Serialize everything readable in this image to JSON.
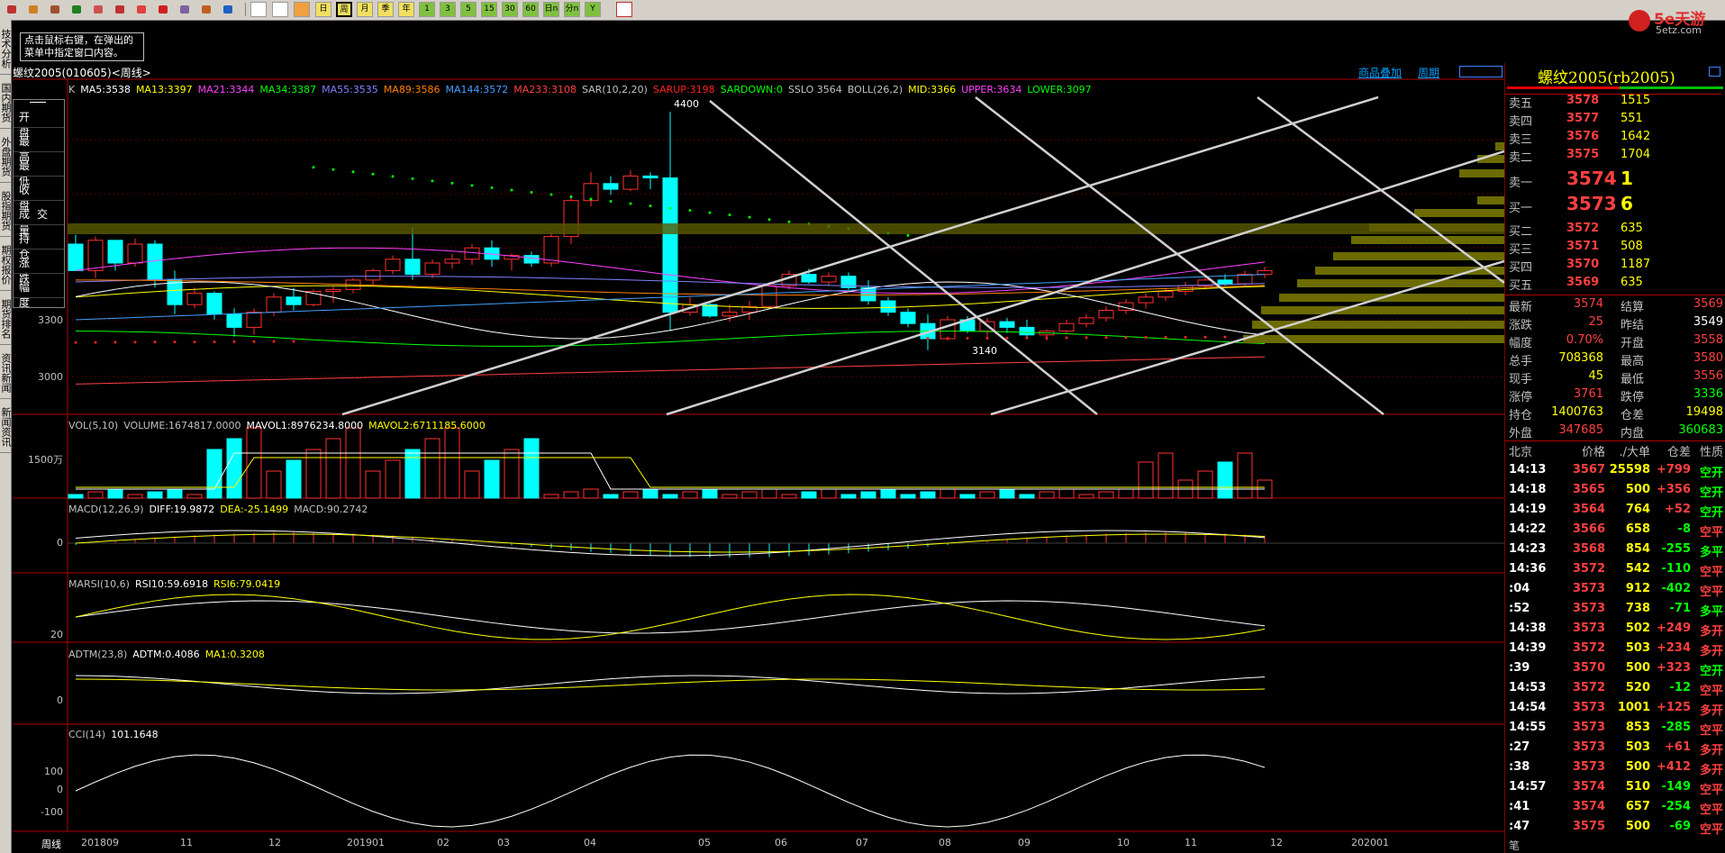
{
  "toolbar": {
    "icons": [
      "system-icon",
      "home-icon",
      "notes-icon",
      "report-icon",
      "refresh-icon",
      "zoom-in-icon",
      "zoom-out-icon",
      "draw-pen-icon",
      "eraser-icon",
      "filter-icon",
      "formula-icon",
      "table-icon",
      "trend-icon",
      "tick-icon",
      "day-icon",
      "week-icon",
      "month-icon",
      "quarter-icon",
      "year-icon",
      "min1-icon",
      "min3-icon",
      "min5-icon",
      "min15-icon",
      "min30-icon",
      "min60-icon",
      "multi-day-icon",
      "multi-min-icon",
      "custom-period-icon",
      "calculator-icon"
    ],
    "period_buttons": [
      "日",
      "周",
      "月",
      "季",
      "年",
      "1",
      "3",
      "5",
      "15",
      "30",
      "60",
      "日n",
      "分n",
      "Y"
    ]
  },
  "brand": {
    "logo": "5e天游",
    "site": "5etz.com"
  },
  "left_tabs": [
    "技术分析",
    "国内期货",
    "外盘期货",
    "股指期货",
    "期权报价",
    "期货排名",
    "资讯新闻",
    "新闻资讯"
  ],
  "notice": {
    "line1": "点击鼠标右键，在弹出的",
    "line2": "菜单中指定窗口内容。"
  },
  "ohlc_labels": [
    "开 盘",
    "最 高",
    "最 低",
    "收 盘",
    "成交量",
    "持 仓",
    "涨 跌",
    "幅 度"
  ],
  "chart_header": {
    "instrument": "螺纹2005(010605)<周线>",
    "tabs": [
      "商品叠加",
      "周期"
    ],
    "ma_line": [
      {
        "t": "K",
        "c": "#c0c0c0"
      },
      {
        "t": "MA5:3538",
        "c": "#ffffff"
      },
      {
        "t": "MA13:3397",
        "c": "#ffff00"
      },
      {
        "t": "MA21:3344",
        "c": "#ff40ff"
      },
      {
        "t": "MA34:3387",
        "c": "#00ff00"
      },
      {
        "t": "MA55:3535",
        "c": "#8080ff"
      },
      {
        "t": "MA89:3586",
        "c": "#ff8000"
      },
      {
        "t": "MA144:3572",
        "c": "#40a0ff"
      },
      {
        "t": "MA233:3108",
        "c": "#ff4040"
      },
      {
        "t": "SAR(10,2,20)",
        "c": "#c0c0c0"
      },
      {
        "t": "SARUP:3198",
        "c": "#ff2020"
      },
      {
        "t": "SARDOWN:0",
        "c": "#00ff00"
      },
      {
        "t": "SSLO 3564",
        "c": "#c0c0c0"
      },
      {
        "t": "BOLL(26,2)",
        "c": "#c0c0c0"
      },
      {
        "t": "MID:3366",
        "c": "#ffff00"
      },
      {
        "t": "UPPER:3634",
        "c": "#ff40ff"
      },
      {
        "t": "LOWER:3097",
        "c": "#00ff00"
      }
    ],
    "y_ticks": [
      "3300",
      "3000"
    ],
    "annot_high": "4400",
    "annot_low": "3140"
  },
  "vol_panel": {
    "line": [
      {
        "t": "VOL(5,10)",
        "c": "#c0c0c0"
      },
      {
        "t": "VOLUME:1674817.0000",
        "c": "#c0c0c0"
      },
      {
        "t": "MAVOL1:8976234.8000",
        "c": "#ffffff"
      },
      {
        "t": "MAVOL2:6711185.6000",
        "c": "#ffff00"
      }
    ],
    "y_tick": "1500万"
  },
  "macd_panel": {
    "line": [
      {
        "t": "MACD(12,26,9)",
        "c": "#c0c0c0"
      },
      {
        "t": "DIFF:19.9872",
        "c": "#ffffff"
      },
      {
        "t": "DEA:-25.1499",
        "c": "#ffff00"
      },
      {
        "t": "MACD:90.2742",
        "c": "#c0c0c0"
      }
    ],
    "y_tick": "0"
  },
  "rsi_panel": {
    "line": [
      {
        "t": "MARSI(10,6)",
        "c": "#c0c0c0"
      },
      {
        "t": "RSI10:59.6918",
        "c": "#ffffff"
      },
      {
        "t": "RSI6:79.0419",
        "c": "#ffff00"
      }
    ],
    "y_tick": "20"
  },
  "adtm_panel": {
    "line": [
      {
        "t": "ADTM(23,8)",
        "c": "#c0c0c0"
      },
      {
        "t": "ADTM:0.4086",
        "c": "#ffffff"
      },
      {
        "t": "MA1:0.3208",
        "c": "#ffff00"
      }
    ],
    "y_tick": "0"
  },
  "cci_panel": {
    "line": [
      {
        "t": "CCI(14)",
        "c": "#c0c0c0"
      },
      {
        "t": "101.1648",
        "c": "#ffffff"
      }
    ],
    "y_ticks": [
      "100",
      "0",
      "-100"
    ]
  },
  "x_axis": {
    "period_label": "周线",
    "labels": [
      "201809",
      "11",
      "12",
      "201901",
      "02",
      "03",
      "04",
      "05",
      "06",
      "07",
      "08",
      "09",
      "10",
      "11",
      "12",
      "202001"
    ]
  },
  "quote": {
    "title": "螺纹2005(rb2005)",
    "asks": [
      {
        "label": "卖五",
        "price": "3578",
        "vol": "1515"
      },
      {
        "label": "卖四",
        "price": "3577",
        "vol": "551"
      },
      {
        "label": "卖三",
        "price": "3576",
        "vol": "1642"
      },
      {
        "label": "卖二",
        "price": "3575",
        "vol": "1704"
      }
    ],
    "ask1": {
      "label": "卖一",
      "price": "3574",
      "vol": "1"
    },
    "bid1": {
      "label": "买一",
      "price": "3573",
      "vol": "6"
    },
    "bids": [
      {
        "label": "买二",
        "price": "3572",
        "vol": "635"
      },
      {
        "label": "买三",
        "price": "3571",
        "vol": "508"
      },
      {
        "label": "买四",
        "price": "3570",
        "vol": "1187"
      },
      {
        "label": "买五",
        "price": "3569",
        "vol": "635"
      }
    ],
    "stats": [
      {
        "l1": "最新",
        "v1": "3574",
        "c1": "#ff4040",
        "l2": "结算",
        "v2": "3569",
        "c2": "#ff4040"
      },
      {
        "l1": "涨跌",
        "v1": "25",
        "c1": "#ff4040",
        "l2": "昨结",
        "v2": "3549",
        "c2": "#ffffff"
      },
      {
        "l1": "幅度",
        "v1": "0.70%",
        "c1": "#ff4040",
        "l2": "开盘",
        "v2": "3558",
        "c2": "#ff4040"
      },
      {
        "l1": "总手",
        "v1": "708368",
        "c1": "#ffff00",
        "l2": "最高",
        "v2": "3580",
        "c2": "#ff4040"
      },
      {
        "l1": "现手",
        "v1": "45",
        "c1": "#ffff00",
        "l2": "最低",
        "v2": "3556",
        "c2": "#ff4040"
      },
      {
        "l1": "涨停",
        "v1": "3761",
        "c1": "#ff4040",
        "l2": "跌停",
        "v2": "3336",
        "c2": "#00ff00"
      },
      {
        "l1": "持仓",
        "v1": "1400763",
        "c1": "#ffff00",
        "l2": "仓差",
        "v2": "19498",
        "c2": "#ffff00"
      },
      {
        "l1": "外盘",
        "v1": "347685",
        "c1": "#ff4040",
        "l2": "内盘",
        "v2": "360683",
        "c2": "#00ff00"
      }
    ],
    "tick_header": [
      "北京",
      "价格",
      "./大单",
      "仓差",
      "性质"
    ],
    "ticks": [
      {
        "t": "14:13",
        "p": "3567",
        "v": "25598",
        "d": "+799",
        "n": "空开",
        "dc": "#ff4040",
        "nc": "#00ff00"
      },
      {
        "t": "14:18",
        "p": "3565",
        "v": "500",
        "d": "+356",
        "n": "空开",
        "dc": "#ff4040",
        "nc": "#00ff00"
      },
      {
        "t": "14:19",
        "p": "3564",
        "v": "764",
        "d": "+52",
        "n": "空开",
        "dc": "#ff4040",
        "nc": "#00ff00"
      },
      {
        "t": "14:22",
        "p": "3566",
        "v": "658",
        "d": "-8",
        "n": "空平",
        "dc": "#00ff00",
        "nc": "#ff4040"
      },
      {
        "t": "14:23",
        "p": "3568",
        "v": "854",
        "d": "-255",
        "n": "多平",
        "dc": "#00ff00",
        "nc": "#00ff00"
      },
      {
        "t": "14:36",
        "p": "3572",
        "v": "542",
        "d": "-110",
        "n": "空平",
        "dc": "#00ff00",
        "nc": "#ff4040"
      },
      {
        "t": ":04",
        "p": "3573",
        "v": "912",
        "d": "-402",
        "n": "空平",
        "dc": "#00ff00",
        "nc": "#ff4040"
      },
      {
        "t": ":52",
        "p": "3573",
        "v": "738",
        "d": "-71",
        "n": "多平",
        "dc": "#00ff00",
        "nc": "#00ff00"
      },
      {
        "t": "14:38",
        "p": "3573",
        "v": "502",
        "d": "+249",
        "n": "多开",
        "dc": "#ff4040",
        "nc": "#ff4040"
      },
      {
        "t": "14:39",
        "p": "3572",
        "v": "503",
        "d": "+234",
        "n": "多开",
        "dc": "#ff4040",
        "nc": "#ff4040"
      },
      {
        "t": ":39",
        "p": "3570",
        "v": "500",
        "d": "+323",
        "n": "空开",
        "dc": "#ff4040",
        "nc": "#00ff00"
      },
      {
        "t": "14:53",
        "p": "3572",
        "v": "520",
        "d": "-12",
        "n": "空平",
        "dc": "#00ff00",
        "nc": "#ff4040"
      },
      {
        "t": "14:54",
        "p": "3573",
        "v": "1001",
        "d": "+125",
        "n": "多开",
        "dc": "#ff4040",
        "nc": "#ff4040"
      },
      {
        "t": "14:55",
        "p": "3573",
        "v": "853",
        "d": "-285",
        "n": "空平",
        "dc": "#00ff00",
        "nc": "#ff4040"
      },
      {
        "t": ":27",
        "p": "3573",
        "v": "503",
        "d": "+61",
        "n": "多开",
        "dc": "#ff4040",
        "nc": "#ff4040"
      },
      {
        "t": ":38",
        "p": "3573",
        "v": "500",
        "d": "+412",
        "n": "多开",
        "dc": "#ff4040",
        "nc": "#ff4040"
      },
      {
        "t": "14:57",
        "p": "3574",
        "v": "510",
        "d": "-149",
        "n": "空平",
        "dc": "#00ff00",
        "nc": "#ff4040"
      },
      {
        "t": ":41",
        "p": "3574",
        "v": "657",
        "d": "-254",
        "n": "空平",
        "dc": "#00ff00",
        "nc": "#ff4040"
      },
      {
        "t": ":47",
        "p": "3575",
        "v": "500",
        "d": "-69",
        "n": "空平",
        "dc": "#00ff00",
        "nc": "#ff4040"
      }
    ],
    "footer": "笔"
  }
}
